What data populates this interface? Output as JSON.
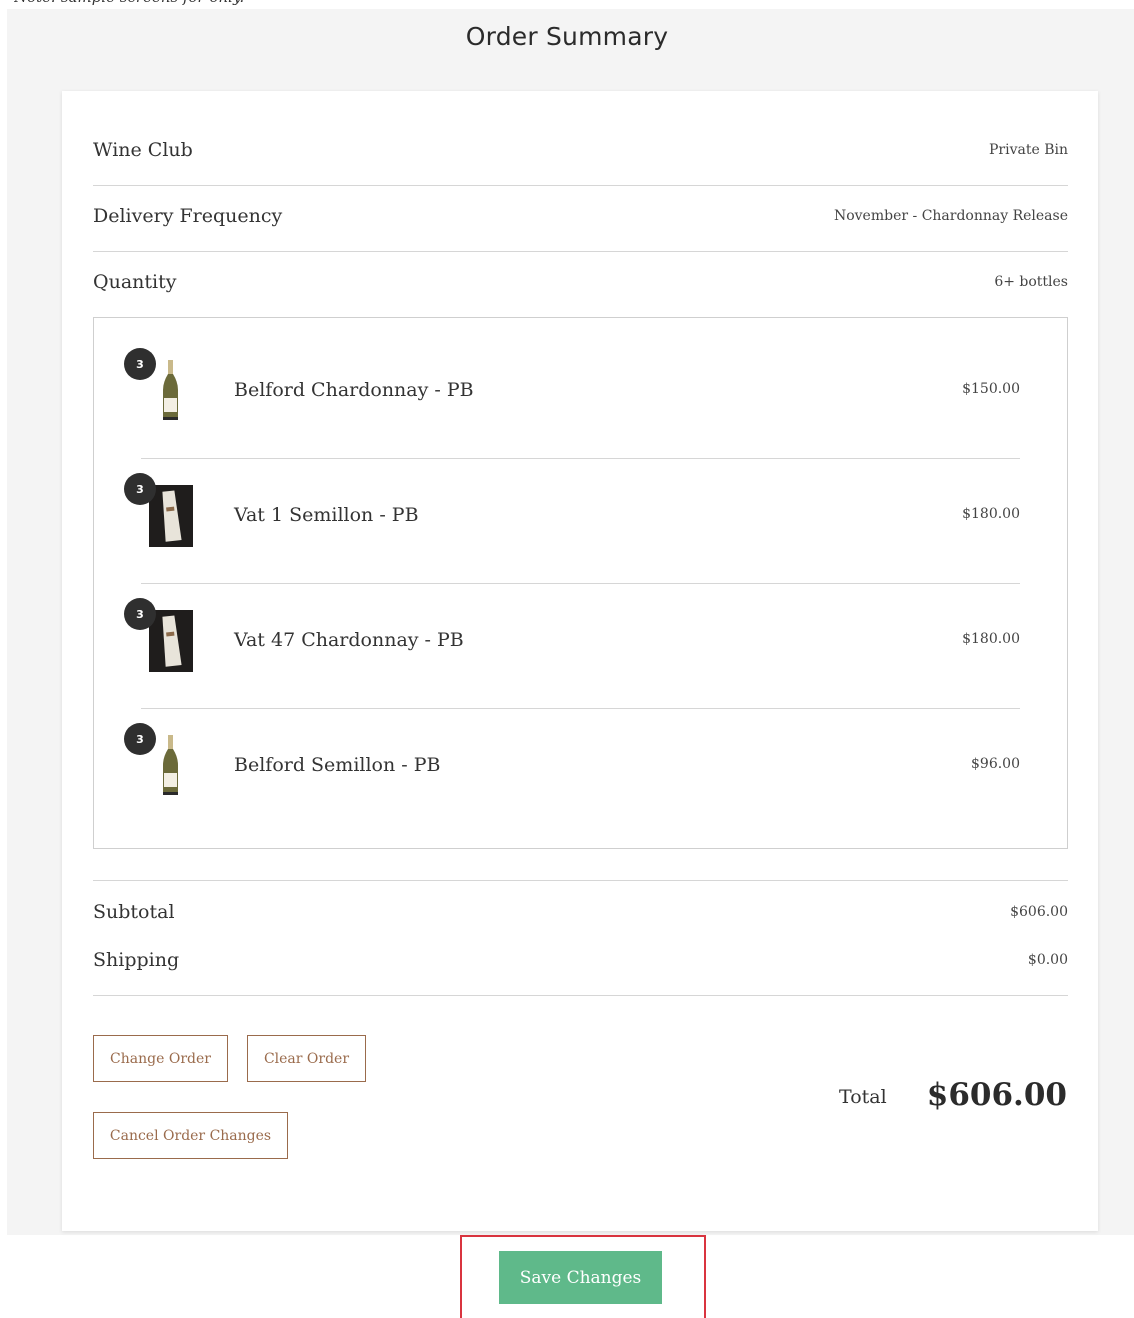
{
  "note": "Note: sample screens for only.",
  "page_title": "Order Summary",
  "summary": {
    "wine_club_label": "Wine Club",
    "wine_club_value": "Private Bin",
    "delivery_label": "Delivery Frequency",
    "delivery_value": "November - Chardonnay Release",
    "quantity_label": "Quantity",
    "quantity_value": "6+ bottles"
  },
  "items": [
    {
      "qty": "3",
      "name": "Belford Chardonnay - PB",
      "price": "$150.00",
      "image": "bottle"
    },
    {
      "qty": "3",
      "name": "Vat 1 Semillon - PB",
      "price": "$180.00",
      "image": "label"
    },
    {
      "qty": "3",
      "name": "Vat 47 Chardonnay - PB",
      "price": "$180.00",
      "image": "label"
    },
    {
      "qty": "3",
      "name": "Belford Semillon - PB",
      "price": "$96.00",
      "image": "bottle"
    }
  ],
  "totals": {
    "subtotal_label": "Subtotal",
    "subtotal_value": "$606.00",
    "shipping_label": "Shipping",
    "shipping_value": "$0.00",
    "total_label": "Total",
    "total_value": "$606.00"
  },
  "buttons": {
    "change_order": "Change Order",
    "clear_order": "Clear Order",
    "cancel_changes": "Cancel Order Changes",
    "save_changes": "Save Changes"
  },
  "colors": {
    "accent_brown": "#9a6b4c",
    "save_green": "#5fb98a",
    "highlight_red": "#d9343f"
  }
}
